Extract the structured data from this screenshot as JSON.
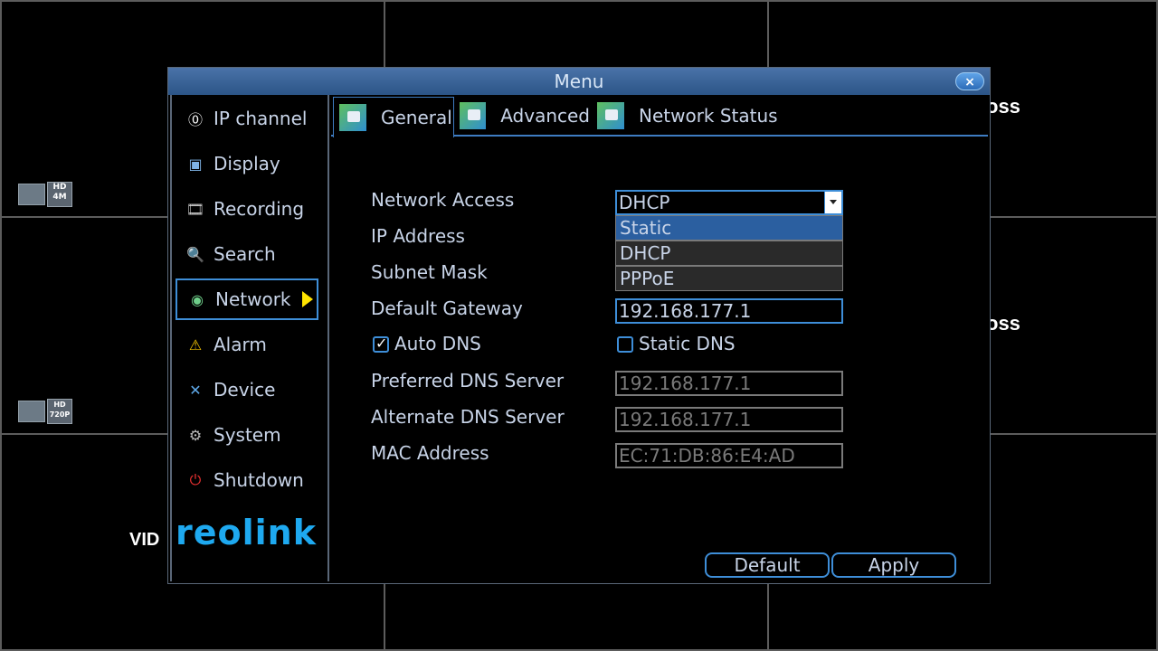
{
  "window": {
    "title": "Menu",
    "close_glyph": "×"
  },
  "sidebar": {
    "items": [
      {
        "label": "IP channel",
        "icon": "ip-channel-icon",
        "glyph": "⓪"
      },
      {
        "label": "Display",
        "icon": "display-icon",
        "glyph": "▣"
      },
      {
        "label": "Recording",
        "icon": "recording-icon",
        "glyph": "🎞"
      },
      {
        "label": "Search",
        "icon": "search-icon",
        "glyph": "🔍"
      },
      {
        "label": "Network",
        "icon": "network-icon",
        "glyph": "◉"
      },
      {
        "label": "Alarm",
        "icon": "alarm-icon",
        "glyph": "⚠"
      },
      {
        "label": "Device",
        "icon": "device-icon",
        "glyph": "✕"
      },
      {
        "label": "System",
        "icon": "system-icon",
        "glyph": "⚙"
      },
      {
        "label": "Shutdown",
        "icon": "shutdown-icon",
        "glyph": "⏻"
      }
    ],
    "active_index": 4,
    "logo": "reolink"
  },
  "tabs": [
    {
      "label": "General"
    },
    {
      "label": "Advanced"
    },
    {
      "label": "Network Status"
    }
  ],
  "form": {
    "network_access": {
      "label": "Network Access",
      "value": "DHCP",
      "options": [
        "Static",
        "DHCP",
        "PPPoE"
      ],
      "highlighted_option": "Static"
    },
    "ip_address": {
      "label": "IP Address"
    },
    "subnet_mask": {
      "label": "Subnet Mask"
    },
    "default_gateway": {
      "label": "Default Gateway",
      "value": "192.168.177.1"
    },
    "auto_dns": {
      "label": "Auto DNS",
      "checked": true
    },
    "static_dns": {
      "label": "Static DNS",
      "checked": false
    },
    "preferred_dns": {
      "label": "Preferred DNS Server",
      "value": "192.168.177.1"
    },
    "alternate_dns": {
      "label": "Alternate DNS Server",
      "value": "192.168.177.1"
    },
    "mac_address": {
      "label": "MAC Address",
      "value": "EC:71:DB:86:E4:AD"
    }
  },
  "buttons": {
    "default_label": "Default",
    "apply_label": "Apply"
  },
  "background": {
    "badges": [
      {
        "hd": "HD",
        "res": "4M"
      },
      {
        "hd": "HD",
        "res": "720P"
      }
    ],
    "ghost_text_1": "oss",
    "ghost_text_2": "oss",
    "vid_text": "VID"
  },
  "colors": {
    "accent": "#3e8ed8",
    "title_bar": "#3a6498",
    "highlight": "#2b5fa0",
    "arrow": "#ffe400"
  }
}
